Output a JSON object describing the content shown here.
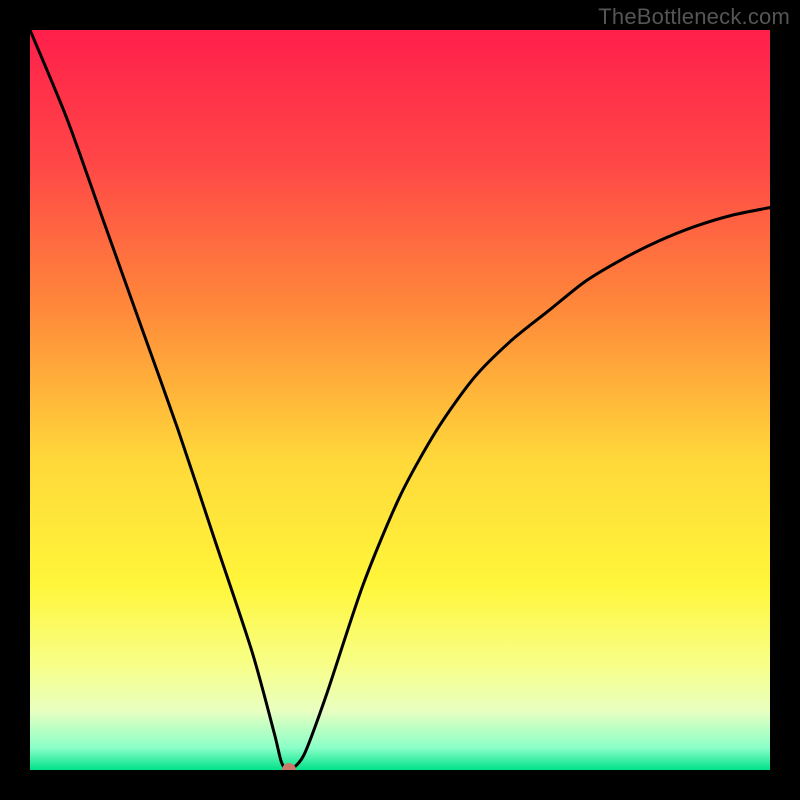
{
  "watermark": "TheBottleneck.com",
  "chart_data": {
    "type": "line",
    "title": "",
    "xlabel": "",
    "ylabel": "",
    "xlim": [
      0,
      100
    ],
    "ylim": [
      0,
      100
    ],
    "grid": false,
    "x": [
      0,
      5,
      10,
      15,
      20,
      25,
      30,
      33,
      34,
      35,
      37,
      40,
      45,
      50,
      55,
      60,
      65,
      70,
      75,
      80,
      85,
      90,
      95,
      100
    ],
    "values": [
      100,
      88,
      74,
      60,
      46,
      31,
      16,
      5,
      1,
      0,
      2,
      10,
      25,
      37,
      46,
      53,
      58,
      62,
      66,
      69,
      71.5,
      73.5,
      75,
      76
    ],
    "marker": {
      "x": 35,
      "y": 0
    },
    "gradient_stops": [
      {
        "pct": 0,
        "color": "#ff1f4b"
      },
      {
        "pct": 18,
        "color": "#ff4747"
      },
      {
        "pct": 38,
        "color": "#ff8a3a"
      },
      {
        "pct": 58,
        "color": "#ffd83a"
      },
      {
        "pct": 75,
        "color": "#fff63a"
      },
      {
        "pct": 86,
        "color": "#f7ff8a"
      },
      {
        "pct": 92,
        "color": "#e8ffc0"
      },
      {
        "pct": 97,
        "color": "#8affc8"
      },
      {
        "pct": 100,
        "color": "#00e28a"
      }
    ],
    "marker_color": "#c97b6b"
  }
}
